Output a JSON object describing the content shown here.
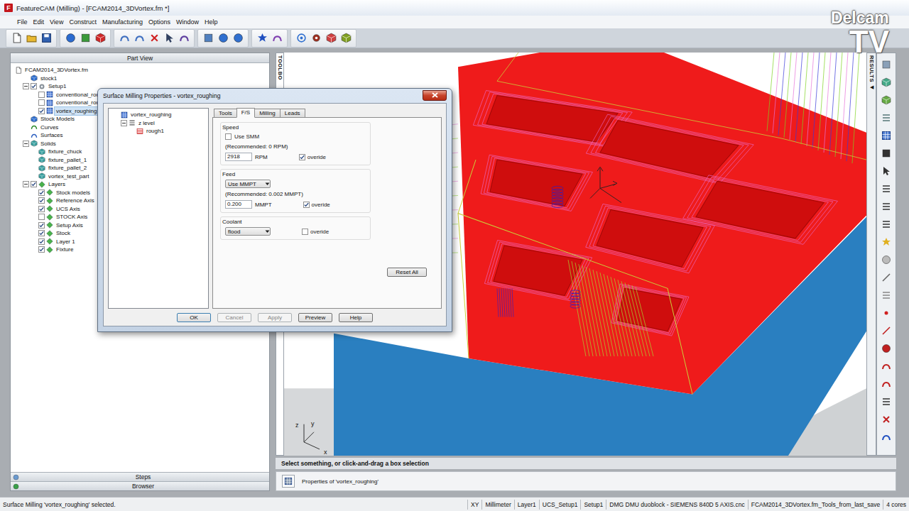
{
  "window": {
    "title": "FeatureCAM (Milling) - [FCAM2014_3DVortex.fm *]",
    "app_icon": "F"
  },
  "menu": [
    "File",
    "Edit",
    "View",
    "Construct",
    "Manufacturing",
    "Options",
    "Window",
    "Help"
  ],
  "watermark": {
    "line1": "Delcam",
    "line2": "TV"
  },
  "part_view": {
    "title": "Part View",
    "items": [
      {
        "label": "FCAM2014_3DVortex.fm",
        "level": 0,
        "kind": "file",
        "expandable": false,
        "expanded": false,
        "has_checkbox": false,
        "checked": false,
        "selected": false
      },
      {
        "label": "stock1",
        "level": 1,
        "kind": "stock",
        "expandable": false,
        "expanded": false,
        "has_checkbox": false,
        "checked": false,
        "selected": false
      },
      {
        "label": "Setup1",
        "level": 1,
        "kind": "setup",
        "expandable": true,
        "expanded": true,
        "has_checkbox": true,
        "checked": true,
        "selected": false
      },
      {
        "label": "conventional_roughi",
        "level": 2,
        "kind": "operation",
        "expandable": false,
        "expanded": false,
        "has_checkbox": true,
        "checked": false,
        "selected": false
      },
      {
        "label": "conventional_roughi",
        "level": 2,
        "kind": "operation",
        "expandable": false,
        "expanded": false,
        "has_checkbox": true,
        "checked": false,
        "selected": false
      },
      {
        "label": "vortex_roughing",
        "level": 2,
        "kind": "operation",
        "expandable": false,
        "expanded": false,
        "has_checkbox": true,
        "checked": true,
        "selected": true
      },
      {
        "label": "Stock Models",
        "level": 1,
        "kind": "stock",
        "expandable": false,
        "expanded": false,
        "has_checkbox": false,
        "checked": false,
        "selected": false
      },
      {
        "label": "Curves",
        "level": 1,
        "kind": "curve",
        "expandable": false,
        "expanded": false,
        "has_checkbox": false,
        "checked": false,
        "selected": false
      },
      {
        "label": "Surfaces",
        "level": 1,
        "kind": "surface",
        "expandable": false,
        "expanded": false,
        "has_checkbox": false,
        "checked": false,
        "selected": false
      },
      {
        "label": "Solids",
        "level": 1,
        "kind": "solid",
        "expandable": true,
        "expanded": true,
        "has_checkbox": false,
        "checked": false,
        "selected": false
      },
      {
        "label": "fixture_chuck",
        "level": 2,
        "kind": "solid",
        "expandable": false,
        "expanded": false,
        "has_checkbox": false,
        "checked": false,
        "selected": false
      },
      {
        "label": "fixture_pallet_1",
        "level": 2,
        "kind": "solid",
        "expandable": false,
        "expanded": false,
        "has_checkbox": false,
        "checked": false,
        "selected": false
      },
      {
        "label": "fixture_pallet_2",
        "level": 2,
        "kind": "solid",
        "expandable": false,
        "expanded": false,
        "has_checkbox": false,
        "checked": false,
        "selected": false
      },
      {
        "label": "vortex_test_part",
        "level": 2,
        "kind": "solid",
        "expandable": false,
        "expanded": false,
        "has_checkbox": false,
        "checked": false,
        "selected": false
      },
      {
        "label": "Layers",
        "level": 1,
        "kind": "layer",
        "expandable": true,
        "expanded": true,
        "has_checkbox": true,
        "checked": true,
        "selected": false
      },
      {
        "label": "Stock models",
        "level": 2,
        "kind": "layer",
        "expandable": false,
        "expanded": false,
        "has_checkbox": true,
        "checked": true,
        "selected": false
      },
      {
        "label": "Reference Axis",
        "level": 2,
        "kind": "layer",
        "expandable": false,
        "expanded": false,
        "has_checkbox": true,
        "checked": true,
        "selected": false
      },
      {
        "label": "UCS Axis",
        "level": 2,
        "kind": "layer",
        "expandable": false,
        "expanded": false,
        "has_checkbox": true,
        "checked": true,
        "selected": false
      },
      {
        "label": "STOCK Axis",
        "level": 2,
        "kind": "layer",
        "expandable": false,
        "expanded": false,
        "has_checkbox": true,
        "checked": false,
        "selected": false
      },
      {
        "label": "Setup Axis",
        "level": 2,
        "kind": "layer",
        "expandable": false,
        "expanded": false,
        "has_checkbox": true,
        "checked": true,
        "selected": false
      },
      {
        "label": "Stock",
        "level": 2,
        "kind": "layer",
        "expandable": false,
        "expanded": false,
        "has_checkbox": true,
        "checked": true,
        "selected": false
      },
      {
        "label": "Layer 1",
        "level": 2,
        "kind": "layer",
        "expandable": false,
        "expanded": false,
        "has_checkbox": true,
        "checked": true,
        "selected": false
      },
      {
        "label": "Fixture",
        "level": 2,
        "kind": "layer",
        "expandable": false,
        "expanded": false,
        "has_checkbox": true,
        "checked": true,
        "selected": false
      }
    ]
  },
  "bottom_tabs": [
    "Steps",
    "Browser"
  ],
  "viewport": {
    "toolbox_label": "TOOLBO",
    "results_label": "RESULTS",
    "results_arrow": "◀",
    "axes": {
      "z": "z",
      "y": "y",
      "x": "x"
    }
  },
  "prompt": "Select something, or click-and-drag a box selection",
  "properties": "Properties of 'vortex_roughing'",
  "status_bar": {
    "message": "Surface Milling 'vortex_roughing' selected.",
    "fields": [
      "XY",
      "Millimeter",
      "Layer1",
      "UCS_Setup1",
      "Setup1",
      "DMG DMU duoblock - SIEMENS 840D 5 AXIS.cnc",
      "FCAM2014_3DVortex.fm_Tools_from_last_save",
      "4 cores"
    ]
  },
  "dialog": {
    "title": "Surface Milling Properties - vortex_roughing",
    "tree": [
      {
        "label": "vortex_roughing",
        "level": 0,
        "kind": "operation",
        "expandable": false,
        "expanded": false
      },
      {
        "label": "z level",
        "level": 1,
        "kind": "feature",
        "expandable": true,
        "expanded": true
      },
      {
        "label": "rough1",
        "level": 2,
        "kind": "step",
        "expandable": false,
        "expanded": false
      }
    ],
    "tabs": [
      {
        "label": "Tools",
        "selected": false
      },
      {
        "label": "F/S",
        "selected": true
      },
      {
        "label": "Milling",
        "selected": false
      },
      {
        "label": "Leads",
        "selected": false
      }
    ],
    "speed": {
      "title": "Speed",
      "use_label": "Use SMM",
      "use_checked": false,
      "recommended": "(Recommended: 0 RPM)",
      "value": "2918",
      "unit": "RPM",
      "override_label": "overide",
      "override": true
    },
    "feed": {
      "title": "Feed",
      "mode": "Use MMPT",
      "recommended": "(Recommended: 0.002 MMPT)",
      "value": "0.200",
      "unit": "MMPT",
      "override_label": "overide",
      "override": true
    },
    "coolant": {
      "title": "Coolant",
      "mode": "flood",
      "override_label": "overide",
      "override": false
    },
    "reset": "Reset All",
    "buttons": [
      {
        "label": "OK",
        "disabled": false,
        "default": true
      },
      {
        "label": "Cancel",
        "disabled": true,
        "default": false
      },
      {
        "label": "Apply",
        "disabled": true,
        "default": false
      },
      {
        "label": "Preview",
        "disabled": false,
        "default": false
      },
      {
        "label": "Help",
        "disabled": false,
        "default": false
      }
    ]
  }
}
